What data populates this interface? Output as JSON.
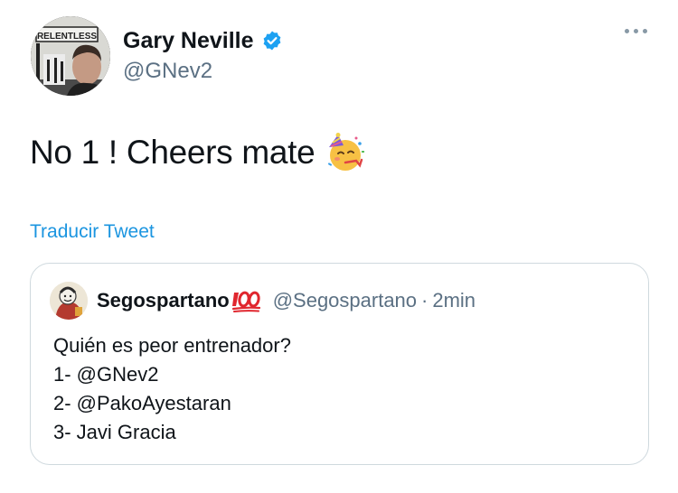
{
  "author": {
    "name": "Gary Neville",
    "handle": "@GNev2",
    "avatar_text": "RELENTLESS",
    "verified_icon": "verified-badge-icon"
  },
  "tweet": {
    "text": "No 1 ! Cheers mate",
    "emoji": "partying-face-emoji",
    "translate_label": "Traducir Tweet"
  },
  "more_icon": "more-options-icon",
  "quote": {
    "name": "Segospartano",
    "name_emoji": "hundred-points-emoji",
    "handle": "@Segospartano",
    "separator": "·",
    "time": "2min",
    "lines": [
      "Quién es peor entrenador?",
      "1- @GNev2",
      "2- @PakoAyestaran",
      "3- Javi Gracia"
    ]
  },
  "colors": {
    "primary_text": "#0f1419",
    "secondary_text": "#5b7083",
    "link": "#1b95e0",
    "verified": "#1da1f2",
    "border": "#cfd9de"
  }
}
